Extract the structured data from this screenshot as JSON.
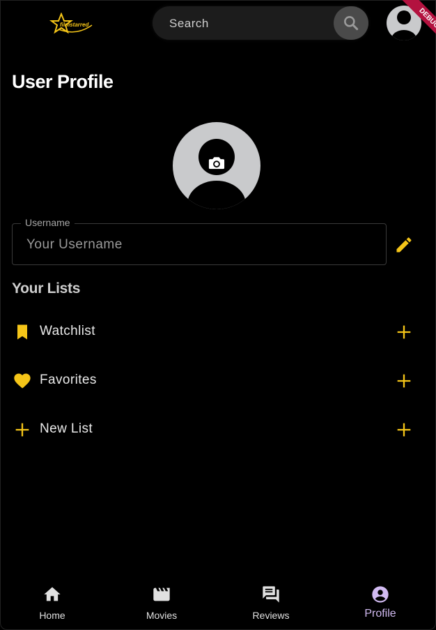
{
  "header": {
    "logo_text": "filmstarred",
    "search_placeholder": "Search",
    "debug_label": "DEBUG"
  },
  "page": {
    "title": "User Profile"
  },
  "profile": {
    "username_label": "Username",
    "username_placeholder": "Your Username"
  },
  "lists": {
    "heading": "Your Lists",
    "items": [
      {
        "label": "Watchlist",
        "icon": "bookmark-icon"
      },
      {
        "label": "Favorites",
        "icon": "heart-icon"
      },
      {
        "label": "New List",
        "icon": "plus-icon"
      }
    ]
  },
  "nav": {
    "items": [
      {
        "label": "Home",
        "icon": "home-icon"
      },
      {
        "label": "Movies",
        "icon": "movie-icon"
      },
      {
        "label": "Reviews",
        "icon": "reviews-icon"
      },
      {
        "label": "Profile",
        "icon": "profile-icon"
      }
    ],
    "active": "Profile"
  },
  "colors": {
    "accent": "#f5c518",
    "active_nav": "#d2bbf2",
    "debug": "#b3123f",
    "avatar_bg": "#c9cacc"
  }
}
